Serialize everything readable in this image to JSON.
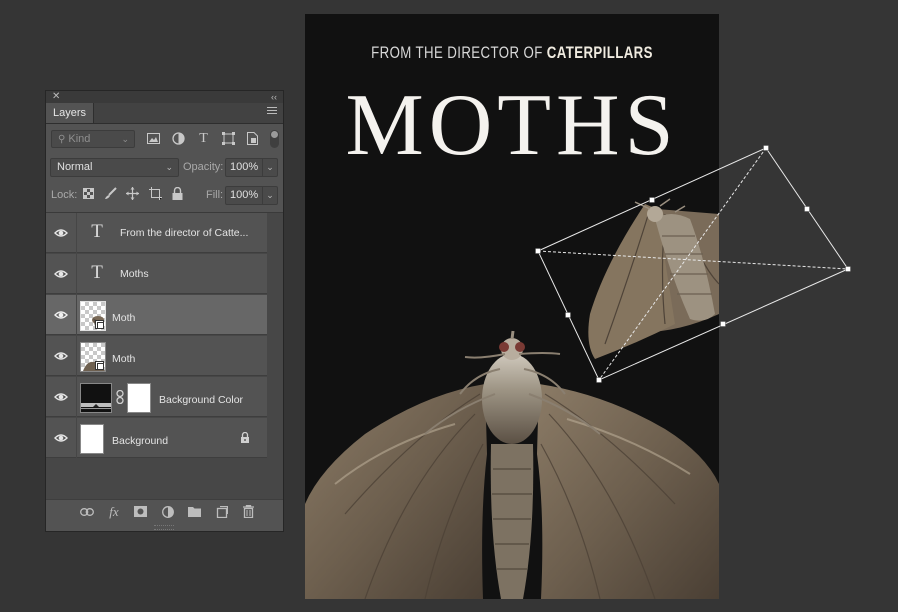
{
  "panel": {
    "close_glyph": "✕",
    "collapse_glyph": "‹‹",
    "tab_label": "Layers",
    "filter": {
      "kind_placeholder": "Kind"
    },
    "blend_mode": "Normal",
    "opacity_label": "Opacity:",
    "opacity_value": "100%",
    "lock_label": "Lock:",
    "fill_label": "Fill:",
    "fill_value": "100%",
    "layers": [
      {
        "name": "From the director of Catte...",
        "type": "text",
        "visible": true,
        "selected": false
      },
      {
        "name": "Moths",
        "type": "text",
        "visible": true,
        "selected": false
      },
      {
        "name": "Moth",
        "type": "smart-object",
        "visible": true,
        "selected": true
      },
      {
        "name": "Moth",
        "type": "smart-object",
        "visible": true,
        "selected": false
      },
      {
        "name": "Background Color",
        "type": "fill-with-mask",
        "visible": true,
        "selected": false
      },
      {
        "name": "Background",
        "type": "background",
        "visible": true,
        "locked": true,
        "selected": false
      }
    ],
    "bottom_icons": [
      "link-layers-icon",
      "fx-icon",
      "add-mask-icon",
      "adjustment-layer-icon",
      "new-group-icon",
      "new-layer-icon",
      "delete-icon"
    ]
  },
  "poster": {
    "tagline_prefix": "FROM THE DIRECTOR OF",
    "tagline_emphasis": "CATERPILLARS",
    "title": "MOTHS"
  },
  "colors": {
    "workspace": "#353535",
    "panel": "#535353",
    "selected_layer": "#676767",
    "poster_bg": "#111111"
  }
}
